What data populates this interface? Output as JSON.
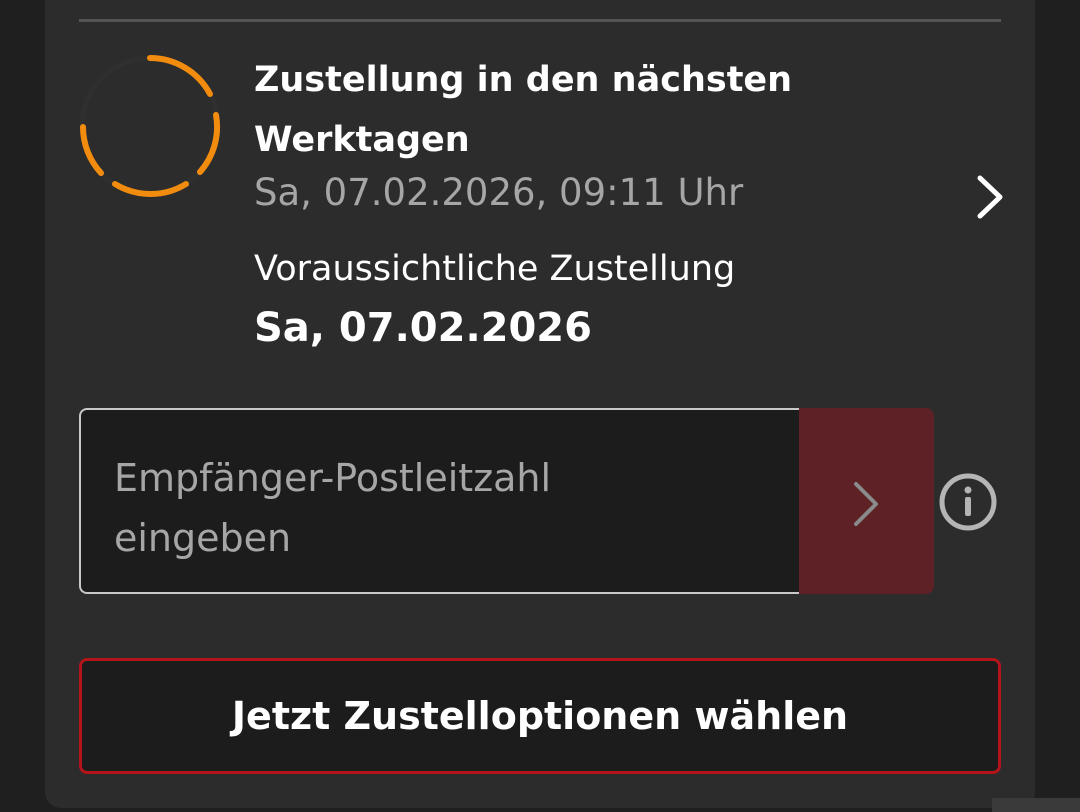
{
  "status": {
    "title": "Zustellung in den nächsten Werktagen",
    "timestamp": "Sa, 07.02.2026, 09:11 Uhr",
    "ring_icon": "progress-ring-icon",
    "ring_color": "#f28c0f"
  },
  "estimated_delivery": {
    "label": "Voraussichtliche Zustellung",
    "date": "Sa, 07.02.2026"
  },
  "zip_entry": {
    "placeholder": "Empfänger-Postleitzahl eingeben",
    "submit_icon": "chevron-right-icon",
    "info_icon": "info-icon"
  },
  "cta": {
    "label": "Jetzt Zustelloptionen wählen",
    "border_color": "#b3141c"
  }
}
